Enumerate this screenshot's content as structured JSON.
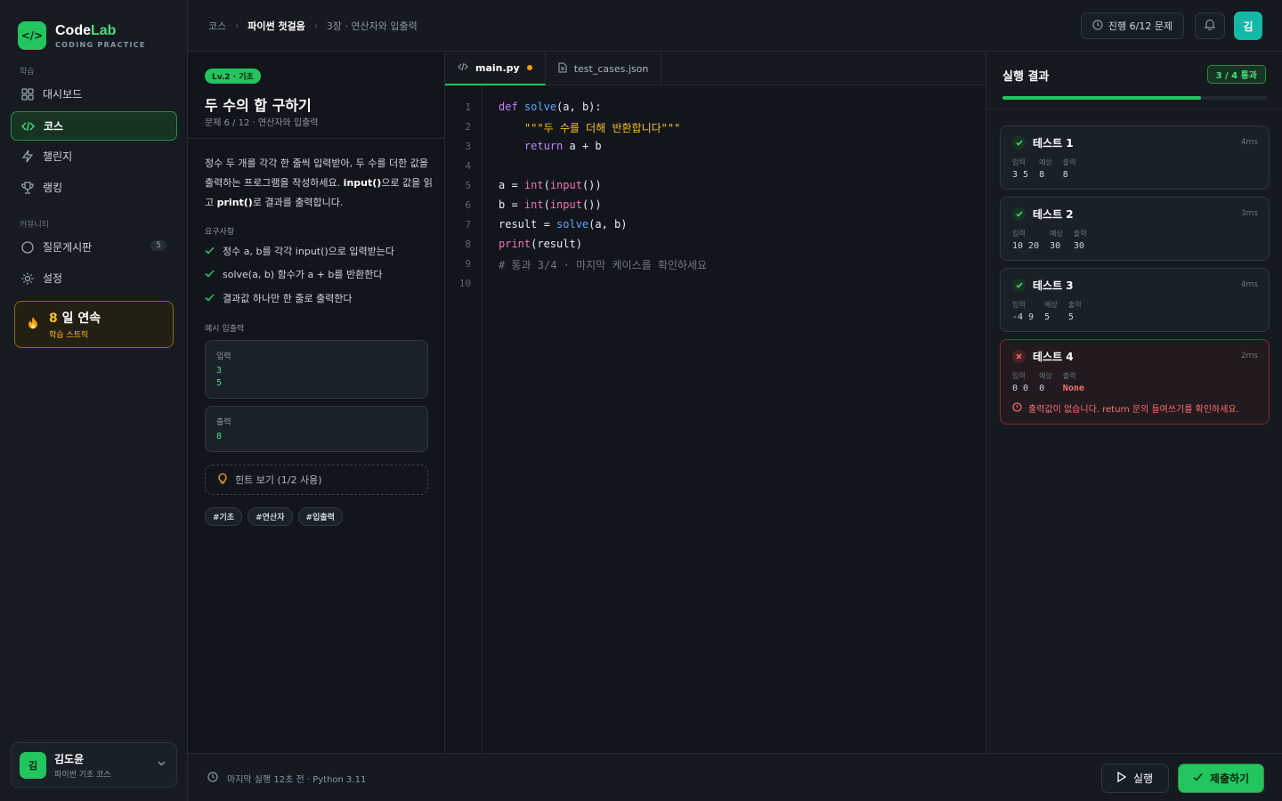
{
  "brand": {
    "logo_glyph": "</>",
    "name_main": "Code",
    "name_accent": "Lab",
    "subtitle": "CODING PRACTICE"
  },
  "sidebar": {
    "section_learn": "학습",
    "section_community": "커뮤니티",
    "items": [
      {
        "label": "대시보드",
        "icon": "grid-icon"
      },
      {
        "label": "코스",
        "icon": "code-icon",
        "active": true
      },
      {
        "label": "챌린지",
        "icon": "bolt-icon"
      },
      {
        "label": "랭킹",
        "icon": "trophy-icon"
      },
      {
        "label": "질문게시판",
        "icon": "chat-icon",
        "badge": "5"
      },
      {
        "label": "설정",
        "icon": "gear-icon"
      }
    ],
    "streak": {
      "number": "8",
      "suffix": " 일 연속",
      "label": "학습 스트릭"
    },
    "user": {
      "initial": "김",
      "name": "김도윤",
      "course": "파이썬 기초 코스"
    }
  },
  "topbar": {
    "breadcrumb": [
      "코스",
      "파이썬 첫걸음",
      "3장 · 연산자와 입출력"
    ],
    "progress_label": "진행 6/12 문제",
    "avatar_initial": "김"
  },
  "problem": {
    "level": "Lv.2 · 기초",
    "title": "두 수의 합 구하기",
    "meta": "문제 6 / 12 · 연산자와 입출력",
    "desc_1": "정수 두 개를 각각 한 줄씩 입력받아, 두 수를 더한 값을 출력하는 프로그램을 작성하세요. ",
    "desc_input": "input()",
    "desc_2": "으로 값을 읽고 ",
    "desc_print": "print()",
    "desc_3": "로 결과를 출력합니다.",
    "requirements_label": "요구사항",
    "requirements": [
      "정수 a, b를 각각 input()으로 입력받는다",
      "solve(a, b) 함수가 a + b를 반환한다",
      "결과값 하나만 한 줄로 출력한다"
    ],
    "example_label": "예시 입출력",
    "example_input_label": "입력",
    "example_input": "3\n5",
    "example_output_label": "출력",
    "example_output": "8",
    "hint": "힌트 보기 (1/2 사용)",
    "tags": [
      "#기초",
      "#연산자",
      "#입출력"
    ]
  },
  "editor": {
    "tabs": [
      {
        "label": "main.py",
        "active": true,
        "dirty": true
      },
      {
        "label": "test_cases.json"
      }
    ],
    "line_numbers": [
      "1",
      "2",
      "3",
      "4",
      "5",
      "6",
      "7",
      "8",
      "9",
      "10"
    ]
  },
  "results": {
    "title": "실행 결과",
    "summary": "3 / 4 통과",
    "passed_fraction": 0.75,
    "col_input": "입력",
    "col_expected": "예상",
    "col_output": "출력",
    "tests": [
      {
        "name": "테스트 1",
        "time": "4ms",
        "input": "3 5",
        "expected": "8",
        "output": "8",
        "status": "pass"
      },
      {
        "name": "테스트 2",
        "time": "3ms",
        "input": "10 20",
        "expected": "30",
        "output": "30",
        "status": "pass"
      },
      {
        "name": "테스트 3",
        "time": "4ms",
        "input": "-4 9",
        "expected": "5",
        "output": "5",
        "status": "pass"
      },
      {
        "name": "테스트 4",
        "time": "2ms",
        "input": "0 0",
        "expected": "0",
        "output": "None",
        "status": "fail",
        "error": "출력값이 없습니다. return 문의 들여쓰기를 확인하세요."
      }
    ]
  },
  "bottombar": {
    "last_run": "마지막 실행 12초 전 · Python 3.11",
    "run_label": "실행",
    "submit_label": "제출하기"
  },
  "colors": {
    "accent": "#22c55e",
    "warning": "#f59e0b",
    "error": "#f87171"
  }
}
